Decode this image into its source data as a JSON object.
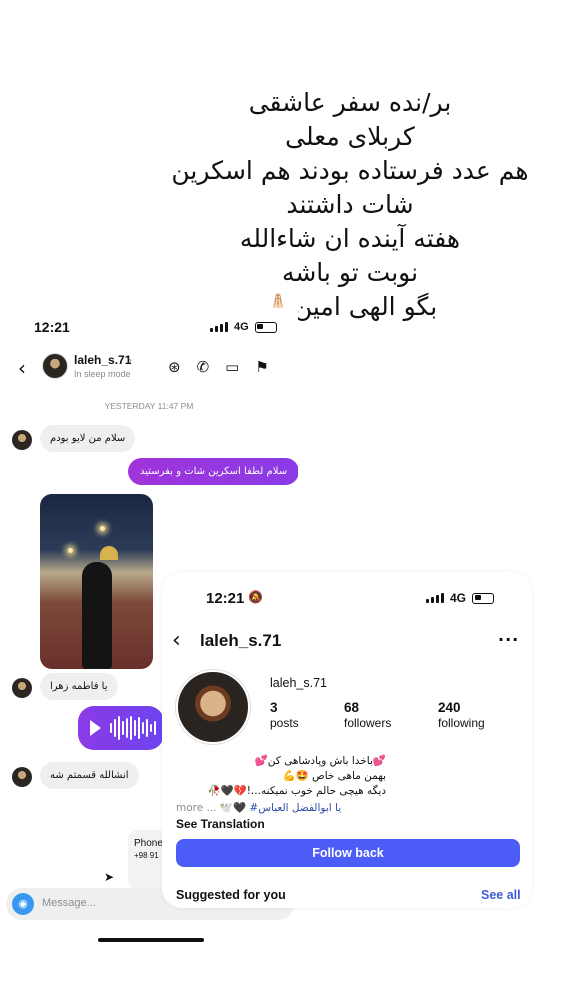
{
  "caption": {
    "lines": [
      "بر/نده سفر عاشقی",
      "کربلای معلی",
      "هم عدد فرستاده بودند هم اسکرین",
      "شات داشتند",
      "هفته آینده ان شاءالله",
      "نوبت تو باشه",
      "بگو الهی امین🙏🏻"
    ]
  },
  "dm": {
    "status": {
      "time": "12:21",
      "network": "4G"
    },
    "header": {
      "username": "laleh_s.71",
      "subtitle": "In sleep mode"
    },
    "timestamp": "YESTERDAY 11:47 PM",
    "messages": {
      "m1": "سلام من لایو بودم",
      "m2": "سلام لطفا اسکرین شات و بفرستید",
      "m3": "یا فاطمه زهرا",
      "m4": "انشالله قسمتم شه"
    },
    "contact": {
      "name": "Phone",
      "number": "+98 91"
    },
    "composer": {
      "placeholder": "Message..."
    },
    "icons": {
      "back": "chevron-left-icon",
      "chevron": "chevron-right-icon",
      "theme": "theme-icon",
      "call": "phone-icon",
      "video": "video-icon",
      "flag": "flag-icon",
      "camera": "camera-icon",
      "mic": "microphone-icon",
      "gallery": "gallery-icon",
      "sticker": "sticker-icon",
      "plus": "plus-icon"
    }
  },
  "profile": {
    "status": {
      "time": "12:21",
      "network": "4G"
    },
    "title": "laleh_s.71",
    "username": "laleh_s.71",
    "stats": {
      "posts": {
        "value": "3",
        "label": "posts"
      },
      "followers": {
        "value": "68",
        "label": "followers"
      },
      "following": {
        "value": "240",
        "label": "following"
      }
    },
    "bio": {
      "line1": "💕باخدا باش وپادشاهی کن💕",
      "line2": "بهمن ماهی خاص 🤩💪",
      "line3": "دیگه هیچی حالم خوب نمیکنه...!💔🖤🥀",
      "line4_prefix": "more ... ",
      "line4": "🕊️🖤 ",
      "line4_tag": "#یا ابوالفضل العباس"
    },
    "see_translation": "See Translation",
    "follow_back": "Follow back",
    "suggested": "Suggested for you",
    "see_all": "See all",
    "colors": {
      "follow_button": "#4c5cf6",
      "link": "#3f5bd6",
      "dm_accent": "#8a3ce6"
    }
  }
}
